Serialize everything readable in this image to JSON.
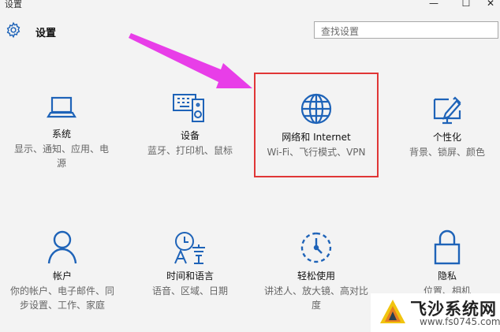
{
  "window": {
    "title": "设置",
    "controls": [
      "—",
      "☐",
      "✕"
    ]
  },
  "header": {
    "title": "设置",
    "icon": "gear-icon"
  },
  "search": {
    "placeholder": "查找设置"
  },
  "tiles": [
    {
      "icon": "laptop-icon",
      "label": "系统",
      "desc": "显示、通知、应用、电源"
    },
    {
      "icon": "devices-icon",
      "label": "设备",
      "desc": "蓝牙、打印机、鼠标"
    },
    {
      "icon": "globe-icon",
      "label": "网络和 Internet",
      "desc": "Wi-Fi、飞行模式、VPN"
    },
    {
      "icon": "personalize-icon",
      "label": "个性化",
      "desc": "背景、锁屏、颜色"
    },
    {
      "icon": "person-icon",
      "label": "帐户",
      "desc": "你的帐户、电子邮件、同步设置、工作、家庭"
    },
    {
      "icon": "time-language-icon",
      "label": "时间和语言",
      "desc": "语音、区域、日期"
    },
    {
      "icon": "ease-of-access-icon",
      "label": "轻松使用",
      "desc": "讲述人、放大镜、高对比度"
    },
    {
      "icon": "lock-icon",
      "label": "隐私",
      "desc": "位置、相机"
    }
  ],
  "watermark": {
    "title": "飞沙系统网",
    "url": "www.fs0745.com"
  },
  "colors": {
    "icon_blue": "#1e63b8",
    "highlight_red": "#e03636",
    "arrow_magenta": "#e83ee8"
  }
}
